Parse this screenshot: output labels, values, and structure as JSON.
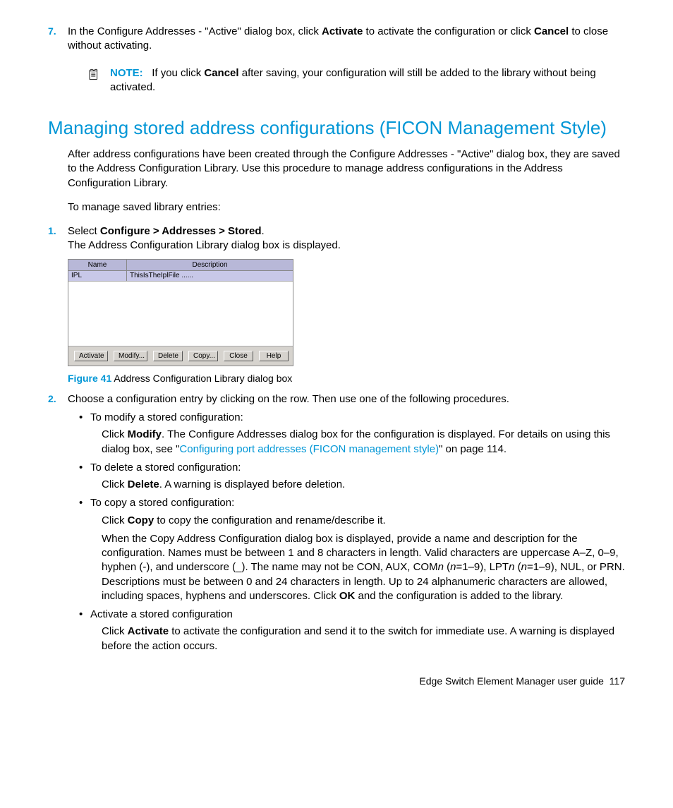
{
  "step7": {
    "num": "7.",
    "text_a": "In the Configure Addresses - \"Active\" dialog box, click ",
    "bold_a": "Activate",
    "text_b": " to activate the configuration or click ",
    "bold_b": "Cancel",
    "text_c": " to close without activating."
  },
  "note": {
    "label": "NOTE:",
    "text_a": "If you click ",
    "bold_a": "Cancel",
    "text_b": " after saving, your configuration will still be added to the library without being activated."
  },
  "heading": "Managing stored address configurations (FICON Management Style)",
  "intro": "After address configurations have been created through the Configure Addresses - \"Active\" dialog box, they are saved to the Address Configuration Library. Use this procedure to manage address configurations in the Address Configuration Library.",
  "intro2": "To manage saved library entries:",
  "step1": {
    "num": "1.",
    "text_a": "Select ",
    "bold_a": "Configure > Addresses > Stored",
    "text_b": ".",
    "line2": "The Address Configuration Library dialog box is displayed."
  },
  "dialog": {
    "col_name": "Name",
    "col_desc": "Description",
    "row1_name": "IPL",
    "row1_desc": "ThisIsTheIplFile ......",
    "buttons": {
      "activate": "Activate",
      "modify": "Modify...",
      "delete": "Delete",
      "copy": "Copy...",
      "close": "Close",
      "help": "Help"
    }
  },
  "figure": {
    "label": "Figure 41",
    "caption": " Address Configuration Library dialog box"
  },
  "step2": {
    "num": "2.",
    "intro": "Choose a configuration entry by clicking on the row. Then use one of the following procedures.",
    "b1": {
      "title": "To modify a stored configuration:",
      "p_a": "Click ",
      "p_bold": "Modify",
      "p_b": ". The Configure Addresses dialog box for the configuration is displayed. For details on using this dialog box, see \"",
      "link": "Configuring port addresses (FICON management style)",
      "p_c": "\" on page 114."
    },
    "b2": {
      "title": "To delete a stored configuration:",
      "p_a": "Click ",
      "p_bold": "Delete",
      "p_b": ". A warning is displayed before deletion."
    },
    "b3": {
      "title": "To copy a stored configuration:",
      "p1_a": "Click ",
      "p1_bold": "Copy",
      "p1_b": " to copy the configuration and rename/describe it.",
      "p2_a": "When the Copy Address Configuration dialog box is displayed, provide a name and description for the configuration. Names must be between 1 and 8 characters in length. Valid characters are uppercase A–Z, 0–9, hyphen (-), and underscore (_). The name may not be CON, AUX, COM",
      "p2_i1": "n",
      "p2_b": " (",
      "p2_i2": "n",
      "p2_c": "=1–9), LPT",
      "p2_i3": "n",
      "p2_d": " (",
      "p2_i4": "n",
      "p2_e": "=1–9), NUL, or PRN. Descriptions must be between 0 and 24 characters in length. Up to 24 alphanumeric characters are allowed, including spaces, hyphens and underscores. Click ",
      "p2_bold": "OK",
      "p2_f": " and the configuration is added to the library."
    },
    "b4": {
      "title": "Activate a stored configuration",
      "p_a": "Click ",
      "p_bold": "Activate",
      "p_b": " to activate the configuration and send it to the switch for immediate use. A warning is displayed before the action occurs."
    }
  },
  "footer": {
    "text": "Edge Switch Element Manager user guide",
    "page": "117"
  }
}
